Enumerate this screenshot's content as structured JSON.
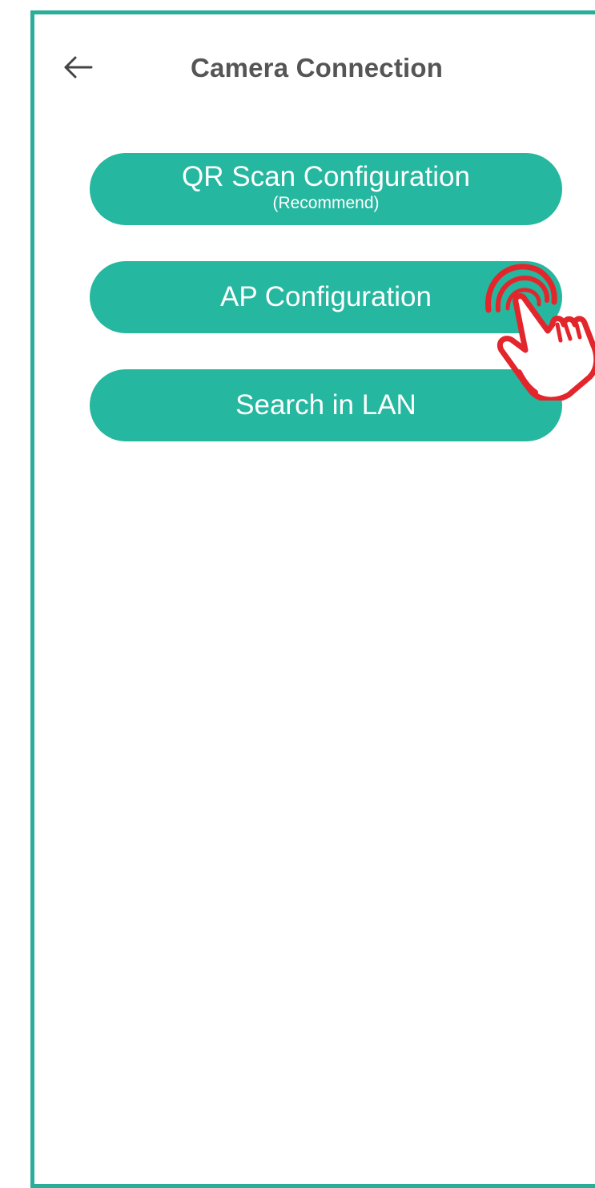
{
  "header": {
    "title": "Camera Connection",
    "back_icon": "arrow-left-icon"
  },
  "buttons": [
    {
      "label": "QR Scan Configuration",
      "sublabel": "(Recommend)"
    },
    {
      "label": "AP Configuration"
    },
    {
      "label": "Search in LAN"
    }
  ],
  "overlay": {
    "icon": "tap-hand-icon",
    "color": "#e3262b"
  },
  "colors": {
    "accent": "#25b79f",
    "frame": "#2bae99",
    "title": "#555555"
  }
}
